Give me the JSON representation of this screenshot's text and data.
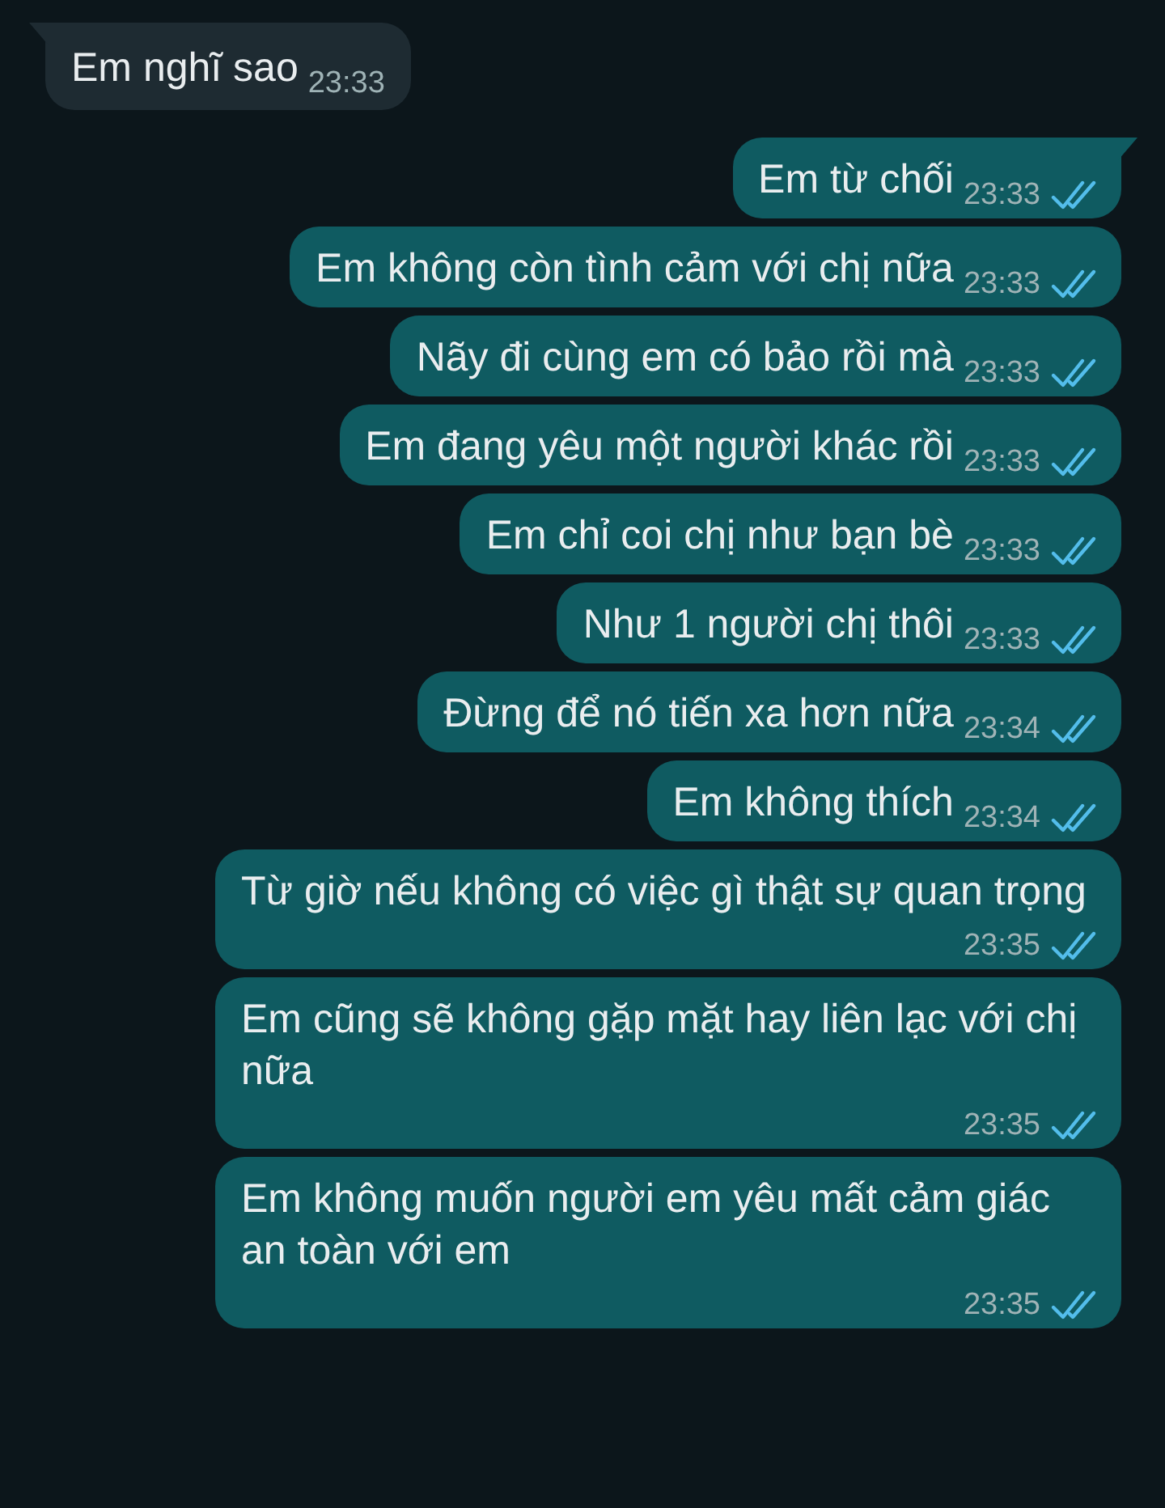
{
  "messages": [
    {
      "kind": "received",
      "text": "Em nghĩ sao",
      "time": "23:33"
    },
    {
      "kind": "sent",
      "text": "Em từ chối",
      "time": "23:33",
      "read": true
    },
    {
      "kind": "sent",
      "text": "Em không còn tình cảm với chị nữa",
      "time": "23:33",
      "read": true
    },
    {
      "kind": "sent",
      "text": "Nãy đi cùng em có bảo rồi mà",
      "time": "23:33",
      "read": true
    },
    {
      "kind": "sent",
      "text": "Em đang yêu một người khác rồi",
      "time": "23:33",
      "read": true
    },
    {
      "kind": "sent",
      "text": "Em chỉ coi chị như bạn bè",
      "time": "23:33",
      "read": true
    },
    {
      "kind": "sent",
      "text": "Như 1 người chị thôi",
      "time": "23:33",
      "read": true
    },
    {
      "kind": "sent",
      "text": "Đừng để nó tiến xa hơn nữa",
      "time": "23:34",
      "read": true
    },
    {
      "kind": "sent",
      "text": "Em không thích",
      "time": "23:34",
      "read": true
    },
    {
      "kind": "sent",
      "text": "Từ giờ nếu không có việc gì thật sự quan trọng",
      "time": "23:35",
      "read": true
    },
    {
      "kind": "sent",
      "text": "Em cũng sẽ không gặp mặt hay liên lạc với chị nữa",
      "time": "23:35",
      "read": true
    },
    {
      "kind": "sent",
      "text": "Em không muốn người em yêu mất cảm giác an toàn với em",
      "time": "23:35",
      "read": true
    }
  ]
}
